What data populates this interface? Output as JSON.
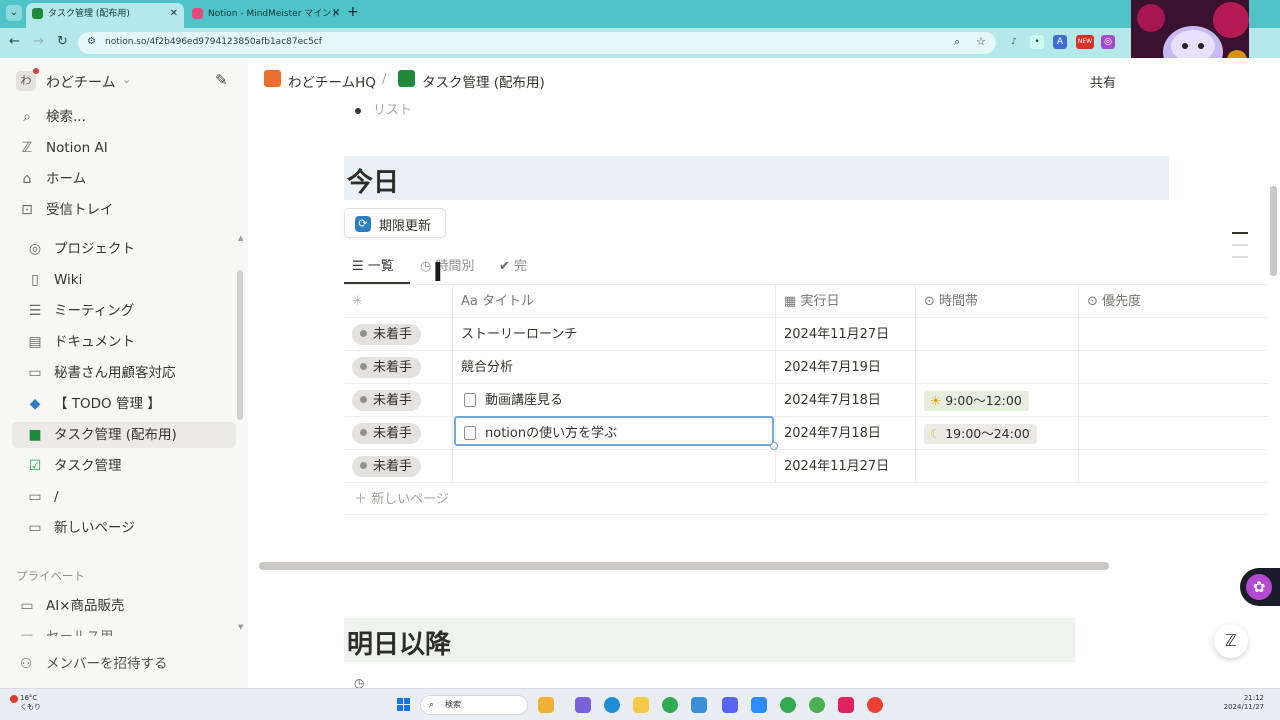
{
  "browser": {
    "tabs": [
      {
        "title": "タスク管理 (配布用)",
        "active": true,
        "favicon_color": "#1f8a3c"
      },
      {
        "title": "Notion - MindMeister マインドマ",
        "active": false,
        "favicon_color": "#e64a7d"
      }
    ],
    "url": "notion.so/4f2b496ed9794123850afb1ac87ec5cf",
    "new_badge": "NEW",
    "accent_color": "#4fc3c7"
  },
  "sidebar": {
    "workspace": {
      "avatar": "わ",
      "name": "わどチーム"
    },
    "items": [
      {
        "icon": "search-icon",
        "label": "検索..."
      },
      {
        "icon": "notion-ai-icon",
        "label": "Notion AI"
      },
      {
        "icon": "home-icon",
        "label": "ホーム"
      },
      {
        "icon": "inbox-icon",
        "label": "受信トレイ"
      }
    ],
    "pages": [
      {
        "icon": "target-icon",
        "label": "プロジェクト"
      },
      {
        "icon": "book-icon",
        "label": "Wiki"
      },
      {
        "icon": "meeting-icon",
        "label": "ミーティング"
      },
      {
        "icon": "document-icon",
        "label": "ドキュメント"
      },
      {
        "icon": "page-icon",
        "label": "秘書さん用顧客対応"
      },
      {
        "icon": "diamond-icon",
        "label": "【 TODO 管理 】"
      },
      {
        "icon": "green-book-icon",
        "label": "タスク管理 (配布用)"
      },
      {
        "icon": "checkbox-icon",
        "label": "タスク管理"
      },
      {
        "icon": "page-icon",
        "label": "/"
      },
      {
        "icon": "page-icon",
        "label": "新しいページ"
      }
    ],
    "private_section": "プライベート",
    "private_pages": [
      {
        "icon": "page-icon",
        "label": "AI×商品販売"
      },
      {
        "icon": "page-icon",
        "label": "セールス用"
      }
    ],
    "invite": "メンバーを招待する"
  },
  "topbar": {
    "breadcrumbs": [
      "わどチームHQ",
      "/",
      "タスク管理 (配布用)"
    ],
    "share": "共有"
  },
  "main": {
    "bullet_text": "リスト",
    "today_heading": "今日",
    "refresh_button": "期限更新",
    "views": [
      {
        "label": "一覧",
        "icon": "list-icon",
        "active": true
      },
      {
        "label": "時間別",
        "icon": "clock-icon",
        "active": false
      },
      {
        "label": "完",
        "icon": "check-circle-icon",
        "active": false
      }
    ],
    "columns": [
      {
        "label": "",
        "icon": "status-spinner-icon"
      },
      {
        "label": "Aa タイトル",
        "icon": ""
      },
      {
        "label": "実行日",
        "icon": "calendar-icon"
      },
      {
        "label": "時間帯",
        "icon": "select-icon"
      },
      {
        "label": "優先度",
        "icon": "select-icon"
      }
    ],
    "rows": [
      {
        "status": "未着手",
        "title": "ストーリーローンチ",
        "has_doc_icon": false,
        "date": "2024年11月27日",
        "time": "",
        "time_icon": "",
        "priority": ""
      },
      {
        "status": "未着手",
        "title": "競合分析",
        "has_doc_icon": false,
        "date": "2024年7月19日",
        "time": "",
        "time_icon": "",
        "priority": ""
      },
      {
        "status": "未着手",
        "title": "動画講座見る",
        "has_doc_icon": true,
        "date": "2024年7月18日",
        "time": "9:00～12:00",
        "time_icon": "sun-icon",
        "priority": ""
      },
      {
        "status": "未着手",
        "title": "notionの使い方を学ぶ",
        "has_doc_icon": true,
        "date": "2024年7月18日",
        "time": "19:00～24:00",
        "time_icon": "moon-icon",
        "priority": ""
      },
      {
        "status": "未着手",
        "title": "",
        "has_doc_icon": false,
        "date": "2024年11月27日",
        "time": "",
        "time_icon": "",
        "priority": ""
      }
    ],
    "new_page": "新しいページ",
    "tomorrow_heading": "明日以降"
  },
  "taskbar": {
    "weather_temp": "16°C",
    "weather_desc": "くもり",
    "search_placeholder": "検索",
    "time": "21:12",
    "date": "2024/11/27"
  }
}
